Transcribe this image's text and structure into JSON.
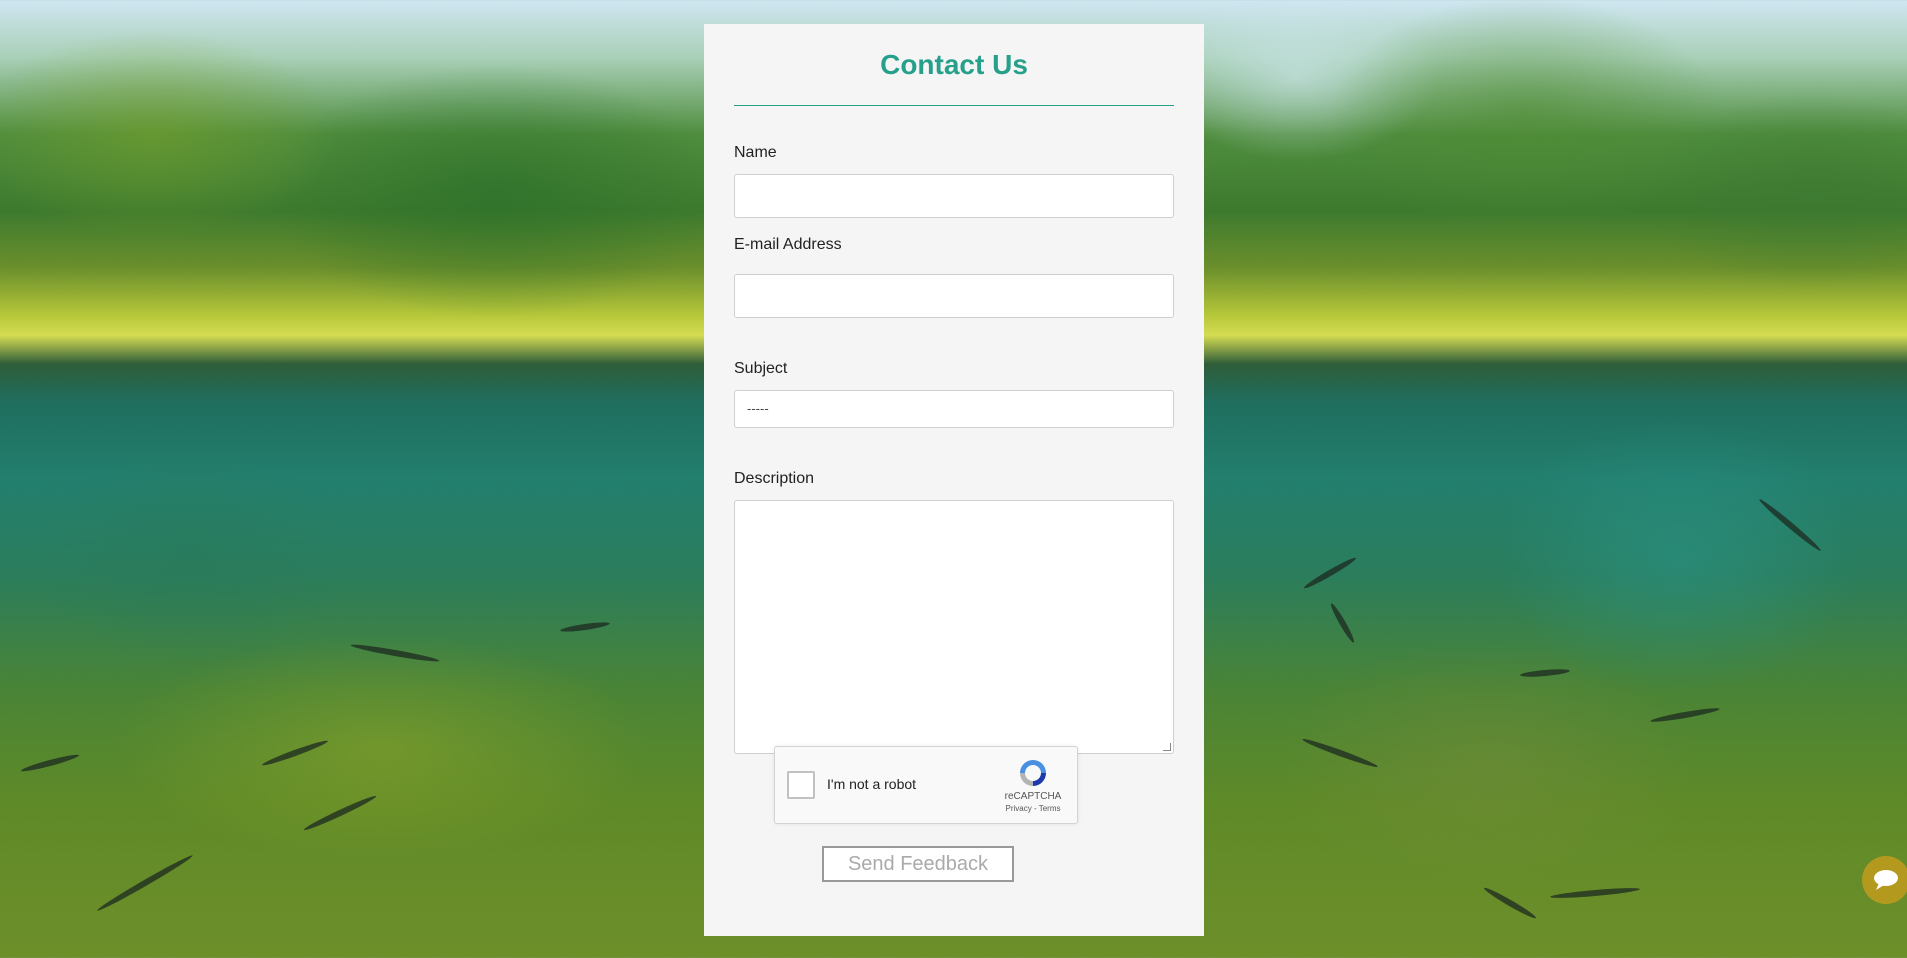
{
  "form": {
    "title": "Contact Us",
    "name_label": "Name",
    "name_value": "",
    "email_label": "E-mail Address",
    "email_value": "",
    "subject_label": "Subject",
    "subject_selected": "-----",
    "description_label": "Description",
    "description_value": "",
    "submit_label": "Send Feedback"
  },
  "captcha": {
    "checkbox_label": "I'm not a robot",
    "brand": "reCAPTCHA",
    "links": "Privacy - Terms"
  },
  "colors": {
    "accent": "#26a08a",
    "chat_bubble": "#b39a1f"
  },
  "icons": {
    "recaptcha": "recaptcha-icon",
    "chat": "chat-icon"
  }
}
